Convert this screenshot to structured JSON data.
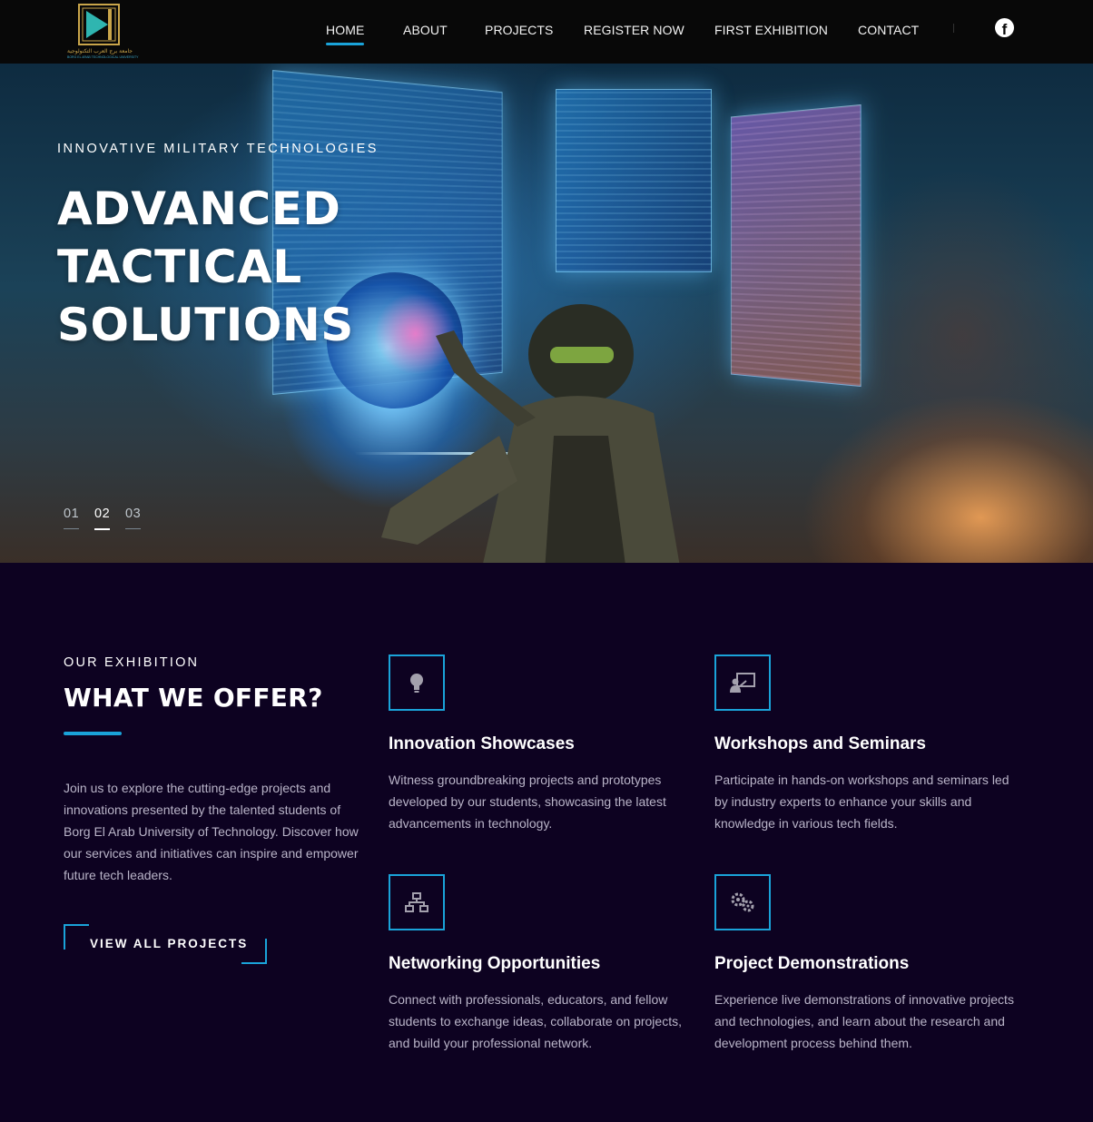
{
  "nav": {
    "logo": {
      "arabic_text": "جامعة برج العرب التكنولوجية",
      "english_text": "BORG EL ARAB TECHNOLOGICAL UNIVERSITY"
    },
    "items": [
      {
        "label": "HOME",
        "active": true
      },
      {
        "label": "ABOUT",
        "active": false
      },
      {
        "label": "PROJECTS",
        "active": false
      },
      {
        "label": "REGISTER NOW",
        "active": false
      },
      {
        "label": "FIRST EXHIBITION",
        "active": false
      },
      {
        "label": "CONTACT",
        "active": false
      }
    ],
    "social_icon": "facebook-icon"
  },
  "hero": {
    "kicker": "INNOVATIVE MILITARY TECHNOLOGIES",
    "title_lines": [
      "ADVANCED",
      "TACTICAL",
      "SOLUTIONS"
    ],
    "slides": [
      {
        "label": "01",
        "active": false
      },
      {
        "label": "02",
        "active": true
      },
      {
        "label": "03",
        "active": false
      }
    ]
  },
  "offer": {
    "eyebrow": "OUR EXHIBITION",
    "title": "WHAT WE OFFER?",
    "intro": "Join us to explore the cutting-edge projects and innovations presented by the talented students of Borg El Arab University of Technology. Discover how our services and initiatives can inspire and empower future tech leaders.",
    "cta_label": "VIEW ALL PROJECTS",
    "accent_color": "#1aa3d9",
    "cards": [
      {
        "icon": "lightbulb-icon",
        "title": "Innovation Showcases",
        "text": "Witness groundbreaking projects and prototypes developed by our students, showcasing the latest advancements in technology."
      },
      {
        "icon": "presentation-board-icon",
        "title": "Workshops and Seminars",
        "text": "Participate in hands-on workshops and seminars led by industry experts to enhance your skills and knowledge in various tech fields."
      },
      {
        "icon": "network-icon",
        "title": "Networking Opportunities",
        "text": "Connect with professionals, educators, and fellow students to exchange ideas, collaborate on projects, and build your professional network."
      },
      {
        "icon": "gears-icon",
        "title": "Project Demonstrations",
        "text": "Experience live demonstrations of innovative projects and technologies, and learn about the research and development process behind them."
      }
    ]
  }
}
